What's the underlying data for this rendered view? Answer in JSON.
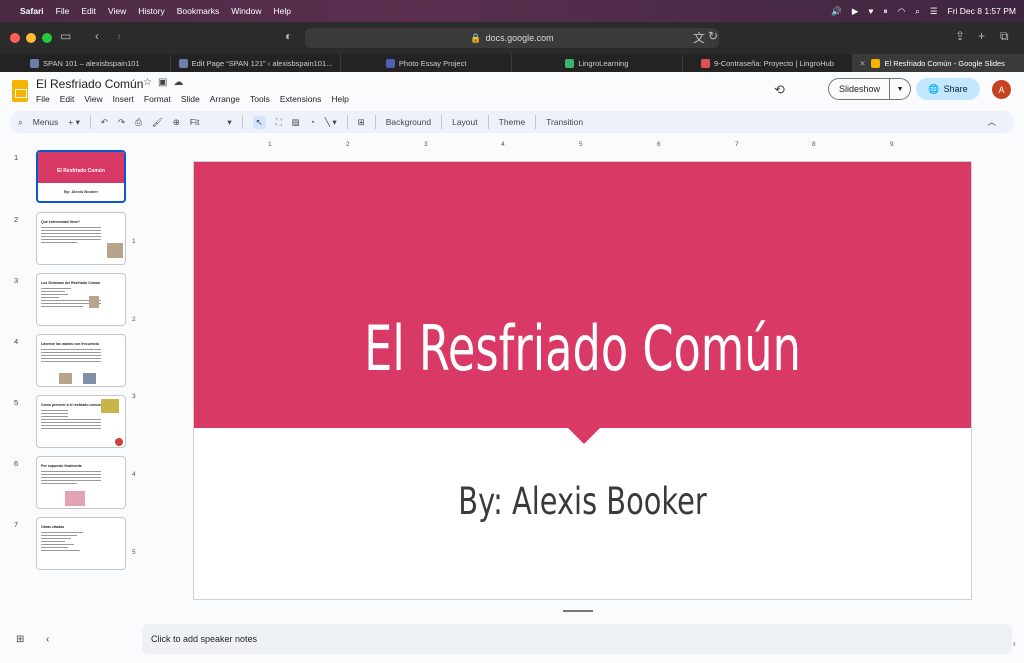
{
  "macos": {
    "app_name": "Safari",
    "menus": [
      "File",
      "Edit",
      "View",
      "History",
      "Bookmarks",
      "Window",
      "Help"
    ],
    "datetime": "Fri Dec 8  1:57 PM"
  },
  "browser": {
    "url": "docs.google.com",
    "tabs": [
      {
        "label": "SPAN 101 – alexisbspain101",
        "active": false
      },
      {
        "label": "Edit Page “SPAN 121” ‹ alexisbspain101...",
        "active": false
      },
      {
        "label": "Photo Essay Project",
        "active": false
      },
      {
        "label": "LingroLearning",
        "active": false
      },
      {
        "label": "9-Contraseña: Proyecto | LingroHub",
        "active": false
      },
      {
        "label": "El Resfriado Común - Google Slides",
        "active": true
      }
    ],
    "close_glyph": "✕"
  },
  "slides_app": {
    "doc_title": "El Resfriado Común",
    "menus": [
      "File",
      "Edit",
      "View",
      "Insert",
      "Format",
      "Slide",
      "Arrange",
      "Tools",
      "Extensions",
      "Help"
    ],
    "slideshow_label": "Slideshow",
    "share_label": "Share",
    "avatar_letter": "A",
    "toolbar": {
      "menus_label": "Menus",
      "zoom_label": "Fit",
      "background_label": "Background",
      "layout_label": "Layout",
      "theme_label": "Theme",
      "transition_label": "Transition"
    },
    "ruler_h": [
      "1",
      "2",
      "3",
      "4",
      "5",
      "6",
      "7",
      "8",
      "9"
    ],
    "ruler_v": [
      "1",
      "2",
      "3",
      "4",
      "5"
    ],
    "thumbnails": [
      {
        "num": "1",
        "title": "El Resfriado Común",
        "subtitle": "By: Alexis Booker"
      },
      {
        "num": "2",
        "title": "Qué enfermedad tiene?"
      },
      {
        "num": "3",
        "title": "Los Síntomas del Resfriado Común"
      },
      {
        "num": "4",
        "title": "Lávense las manos con frecuencia"
      },
      {
        "num": "5",
        "title": "Cómo prevenir a el resfriado común"
      },
      {
        "num": "6",
        "title": "Por supuesto finalmente"
      },
      {
        "num": "7",
        "title": "Obras citadas"
      }
    ],
    "current_slide": {
      "title": "El Resfriado Común",
      "subtitle": "By: Alexis Booker",
      "band_color": "#d93965"
    },
    "speaker_notes_placeholder": "Click to add speaker notes"
  }
}
